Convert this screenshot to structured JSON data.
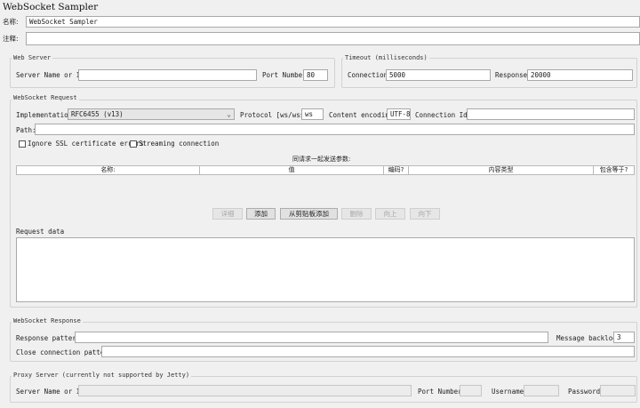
{
  "title": "WebSocket Sampler",
  "name_label": "名称:",
  "name_value": "WebSocket Sampler",
  "comment_label": "注释:",
  "comment_value": "",
  "web_server": {
    "title": "Web Server",
    "server_label": "Server Name or IP:",
    "server_value": "",
    "port_label": "Port Number:",
    "port_value": "80"
  },
  "timeout": {
    "title": "Timeout (milliseconds)",
    "connection_label": "Connection:",
    "connection_value": "5000",
    "response_label": "Response:",
    "response_value": "20000"
  },
  "request": {
    "title": "WebSocket Request",
    "implementation_label": "Implementation:",
    "implementation_value": "RFC6455 (v13)",
    "protocol_label": "Protocol [ws/wss]:",
    "protocol_value": "ws",
    "encoding_label": "Content encoding:",
    "encoding_value": "UTF-8",
    "connection_id_label": "Connection Id:",
    "connection_id_value": "",
    "path_label": "Path:",
    "path_value": "",
    "ignore_ssl_label": "Ignore SSL certificate errors",
    "streaming_label": "Streaming connection",
    "params_caption": "同请求一起发送参数:",
    "columns": [
      "名称:",
      "值",
      "编码?",
      "内容类型",
      "包含等于?"
    ],
    "buttons": {
      "detail": "详细",
      "add": "添加",
      "add_clipboard": "从剪贴板添加",
      "delete": "删除",
      "up": "向上",
      "down": "向下"
    },
    "request_data_label": "Request data"
  },
  "response": {
    "title": "WebSocket Response",
    "pattern_label": "Response pattern:",
    "pattern_value": "",
    "backlog_label": "Message backlog:",
    "backlog_value": "3",
    "close_label": "Close connection pattern:",
    "close_value": ""
  },
  "proxy": {
    "title": "Proxy Server (currently not supported by Jetty)",
    "server_label": "Server Name or IP:",
    "port_label": "Port Number:",
    "username_label": "Username:",
    "password_label": "Password:"
  }
}
